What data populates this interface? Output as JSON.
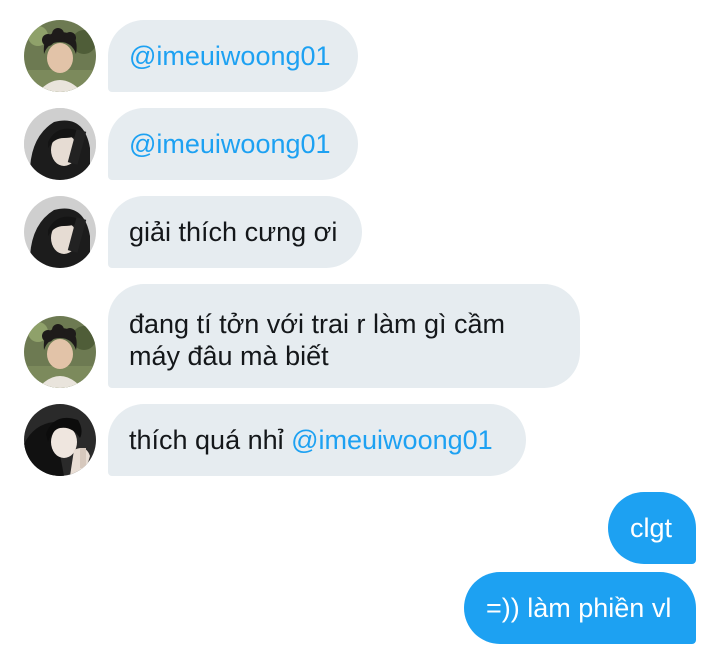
{
  "messages": [
    {
      "sender": "friend-a",
      "avatar_icon": "user-avatar-curly-hair-icon",
      "text_before": "",
      "mention": "@imeuiwoong01"
    },
    {
      "sender": "friend-b",
      "avatar_icon": "user-avatar-long-hair-icon",
      "text_before": "",
      "mention": "@imeuiwoong01"
    },
    {
      "sender": "friend-b",
      "avatar_icon": "user-avatar-long-hair-icon",
      "text": "giải thích cưng ơi"
    },
    {
      "sender": "friend-a",
      "avatar_icon": "user-avatar-curly-hair-icon",
      "line1": "đang tí tởn với trai r làm gì cầm",
      "line2": "máy đâu mà biết"
    },
    {
      "sender": "friend-c",
      "avatar_icon": "user-avatar-dark-hair-icon",
      "text_before": "thích quá nhỉ ",
      "mention": "@imeuiwoong01"
    }
  ],
  "outgoing": [
    {
      "text": "clgt"
    },
    {
      "text": "=)) làm phiền vl"
    }
  ],
  "colors": {
    "incoming_bubble": "#e6ecf0",
    "outgoing_bubble": "#1da1f2",
    "mention": "#1da1f2",
    "incoming_text": "#14171a",
    "outgoing_text": "#ffffff"
  }
}
